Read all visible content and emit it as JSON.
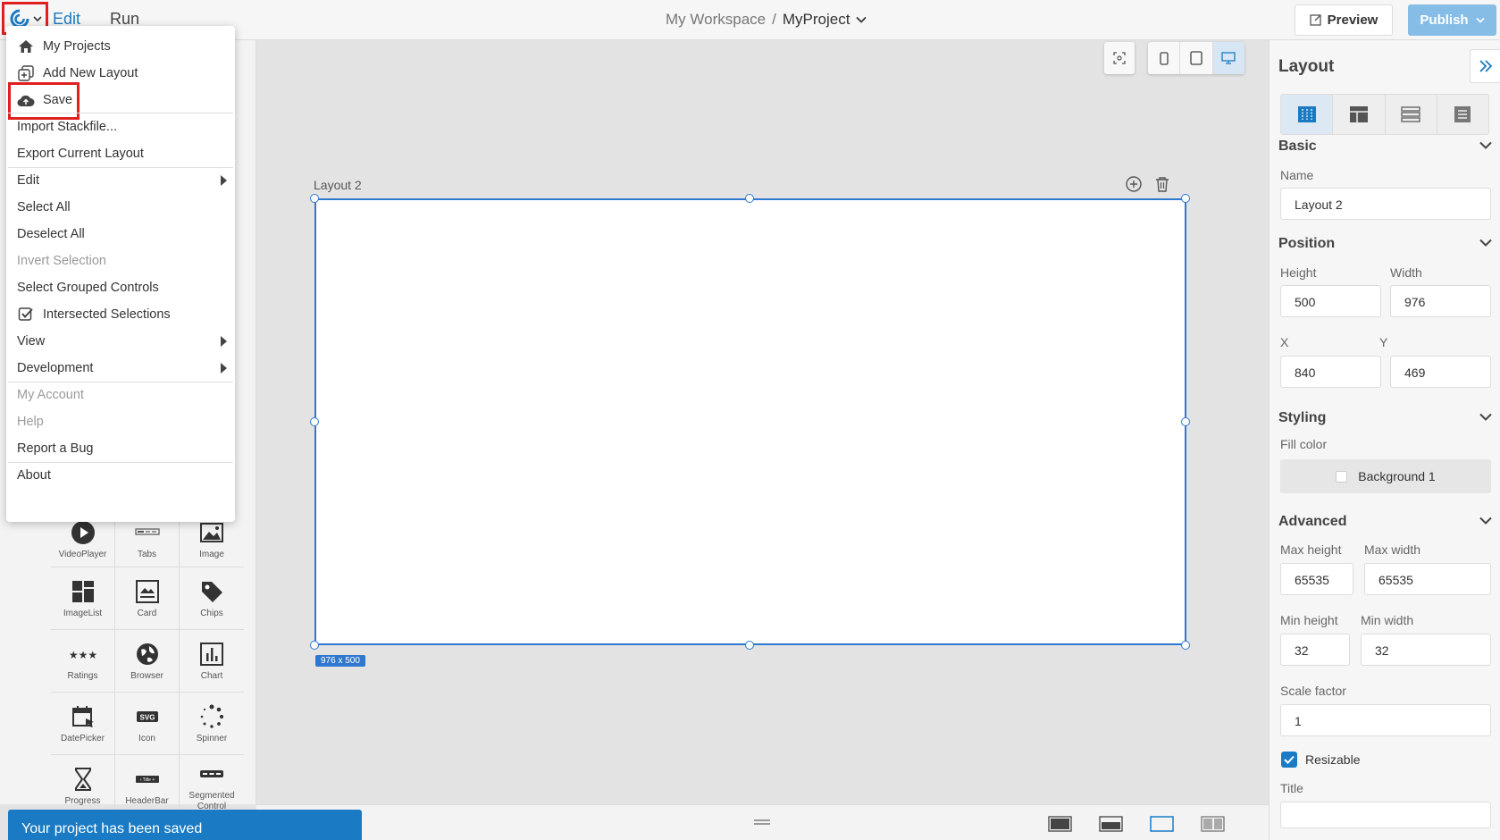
{
  "topbar": {
    "tabs": [
      "Edit",
      "Run"
    ],
    "workspace": "My Workspace",
    "separator": "/",
    "project": "MyProject",
    "preview_label": "Preview",
    "publish_label": "Publish"
  },
  "menu": {
    "items": [
      {
        "label": "My Projects",
        "icon": "home-icon"
      },
      {
        "label": "Add New Layout",
        "icon": "add-layout-icon"
      },
      {
        "label": "Save",
        "icon": "cloud-upload-icon"
      },
      {
        "label": "Import Stackfile..."
      },
      {
        "label": "Export Current Layout"
      },
      {
        "label": "Edit",
        "submenu": true
      },
      {
        "label": "Select All"
      },
      {
        "label": "Deselect All"
      },
      {
        "label": "Invert Selection",
        "disabled": true
      },
      {
        "label": "Select Grouped Controls"
      },
      {
        "label": "Intersected Selections",
        "checked": true
      },
      {
        "label": "View",
        "submenu": true
      },
      {
        "label": "Development",
        "submenu": true
      },
      {
        "label": "My Account",
        "disabled": true
      },
      {
        "label": "Help",
        "disabled": true
      },
      {
        "label": "Report a Bug"
      },
      {
        "label": "About"
      }
    ]
  },
  "palette": [
    [
      "VideoPlayer",
      "Tabs",
      "Image"
    ],
    [
      "ImageList",
      "Card",
      "Chips"
    ],
    [
      "Ratings",
      "Browser",
      "Chart"
    ],
    [
      "DatePicker",
      "Icon",
      "Spinner"
    ],
    [
      "Progress",
      "HeaderBar",
      "Segmented Control"
    ]
  ],
  "canvas": {
    "layout_name": "Layout 2",
    "size_badge": "976 x 500"
  },
  "toast": "Your project has been saved",
  "panel": {
    "title": "Layout",
    "basic": {
      "heading": "Basic",
      "name_label": "Name",
      "name_value": "Layout 2"
    },
    "position": {
      "heading": "Position",
      "height_label": "Height",
      "height_value": "500",
      "width_label": "Width",
      "width_value": "976",
      "x_label": "X",
      "x_value": "840",
      "y_label": "Y",
      "y_value": "469"
    },
    "styling": {
      "heading": "Styling",
      "fill_label": "Fill color",
      "fill_value": "Background 1"
    },
    "advanced": {
      "heading": "Advanced",
      "max_height_label": "Max height",
      "max_height_value": "65535",
      "max_width_label": "Max width",
      "max_width_value": "65535",
      "min_height_label": "Min height",
      "min_height_value": "32",
      "min_width_label": "Min width",
      "min_width_value": "32",
      "scale_label": "Scale factor",
      "scale_value": "1",
      "resizable_label": "Resizable",
      "title_label": "Title"
    }
  },
  "colors": {
    "accent": "#1a7bc4",
    "selection": "#2f78cf",
    "highlight": "#e02020"
  }
}
